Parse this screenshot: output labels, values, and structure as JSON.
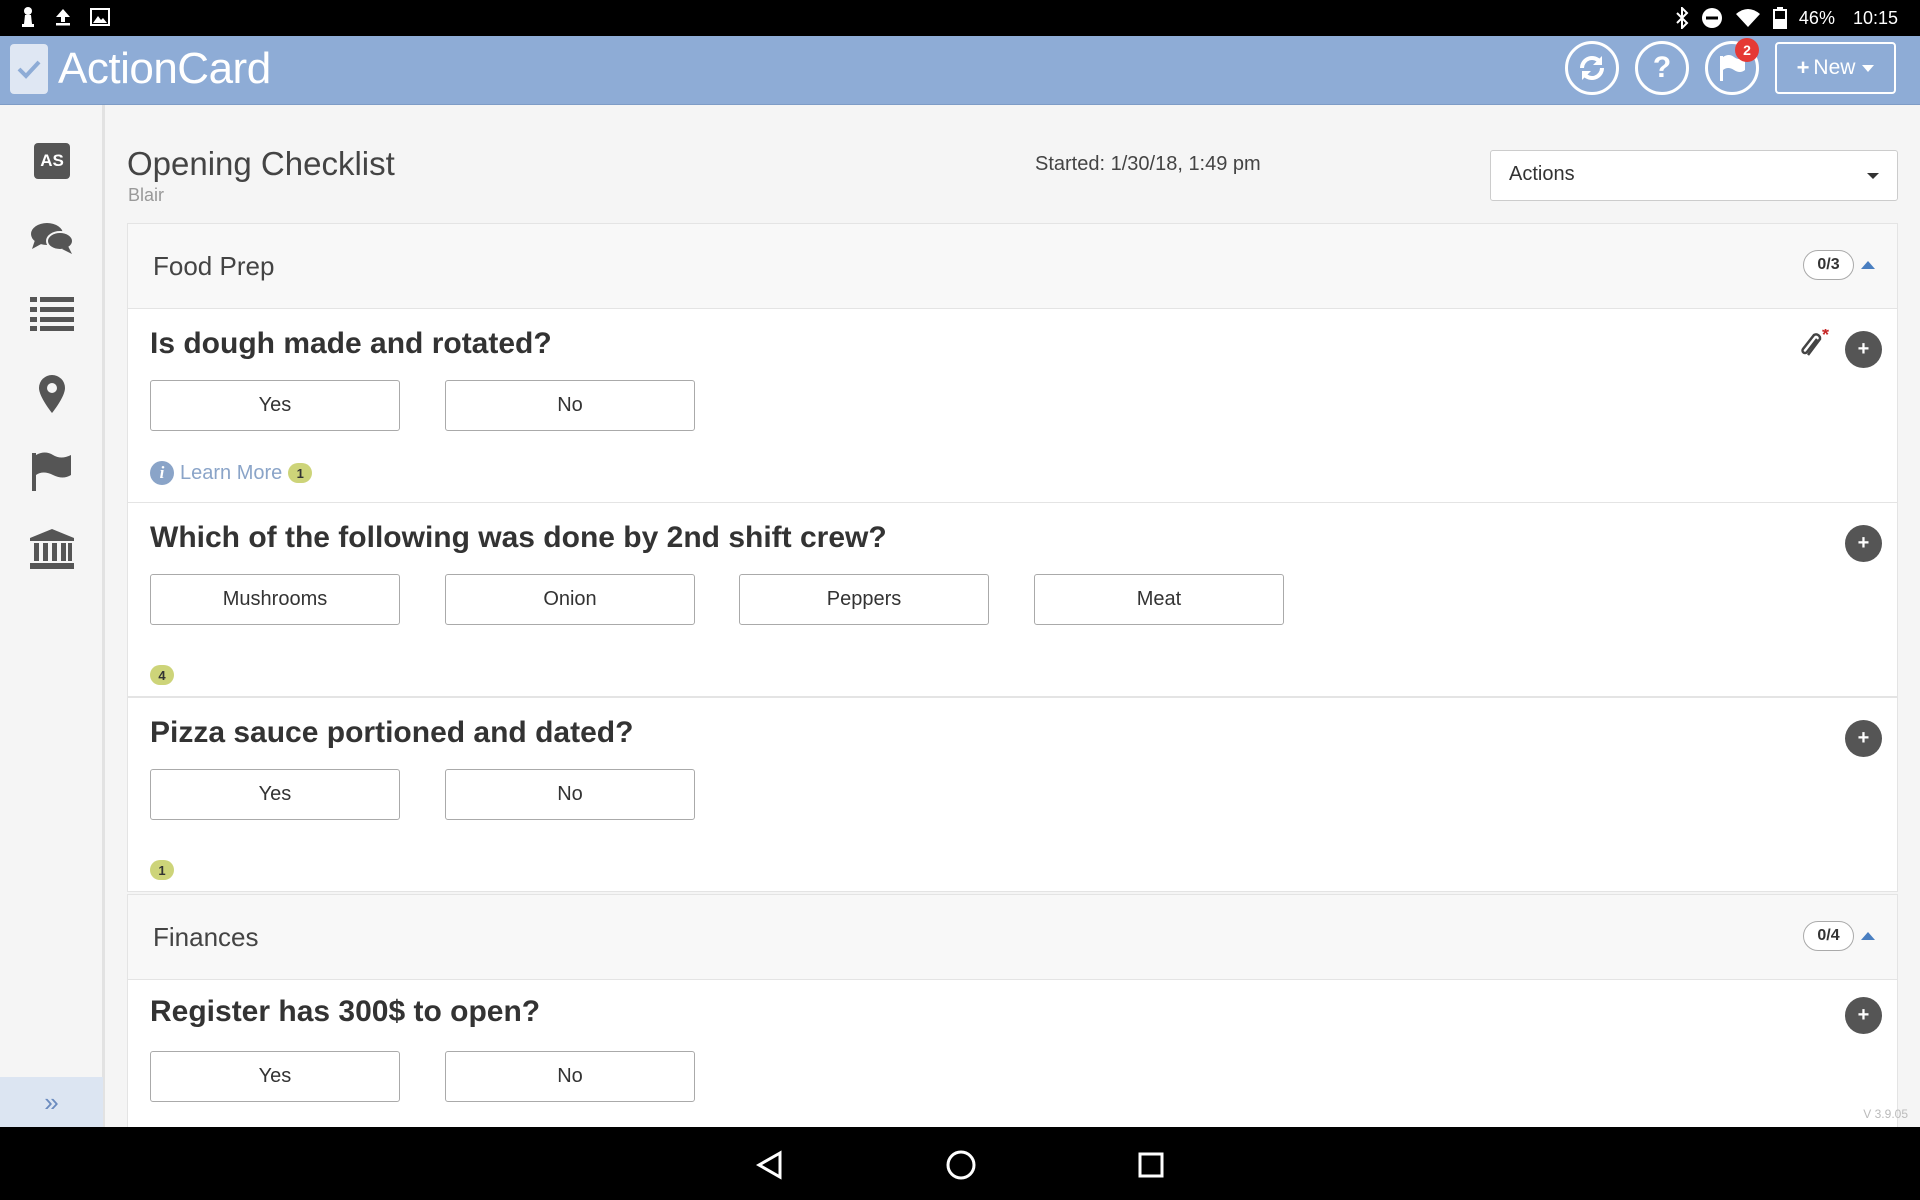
{
  "status_bar": {
    "battery": "46%",
    "time": "10:15"
  },
  "header": {
    "app_name": "ActionCard",
    "flag_badge": "2",
    "new_label": "New"
  },
  "page": {
    "title": "Opening Checklist",
    "subtitle": "Blair",
    "started": "Started: 1/30/18, 1:49 pm",
    "actions_label": "Actions"
  },
  "sections": [
    {
      "name": "Food Prep",
      "count": "0/3",
      "questions": [
        {
          "text": "Is dough made and rotated?",
          "options": [
            "Yes",
            "No"
          ],
          "learn_more": "Learn More",
          "badge": "1"
        },
        {
          "text": "Which of the following was done by 2nd shift crew?",
          "options": [
            "Mushrooms",
            "Onion",
            "Peppers",
            "Meat"
          ],
          "badge": "4"
        },
        {
          "text": "Pizza sauce portioned and dated?",
          "options": [
            "Yes",
            "No"
          ],
          "badge": "1"
        }
      ]
    },
    {
      "name": "Finances",
      "count": "0/4",
      "questions": [
        {
          "text": "Register has 300$ to open?",
          "options": [
            "Yes",
            "No"
          ]
        }
      ]
    }
  ],
  "sidebar": {
    "avatar_initials": "AS",
    "expand_glyph": "»"
  },
  "version": "V 3.9.05",
  "colors": {
    "header_bg": "#8eacd6",
    "badge_red": "#e53935",
    "badge_yellow": "#cdd479",
    "link_blue": "#8aa4c8"
  }
}
